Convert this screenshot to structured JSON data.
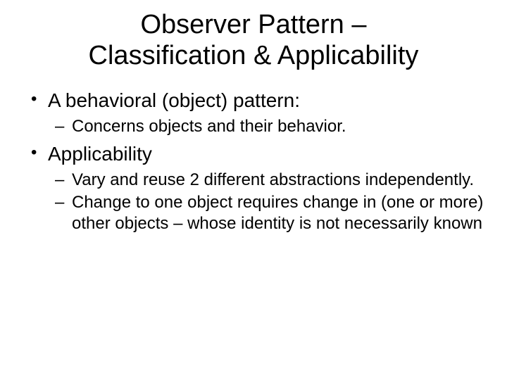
{
  "title_line1": "Observer Pattern –",
  "title_line2": "Classification & Applicability",
  "bullets": [
    {
      "text": "A behavioral (object) pattern:",
      "subs": [
        "Concerns objects and their behavior."
      ]
    },
    {
      "text": "Applicability",
      "subs": [
        "Vary and reuse 2 different abstractions independently.",
        "Change to one object requires change in (one or more) other objects – whose identity is not necessarily known"
      ]
    }
  ]
}
